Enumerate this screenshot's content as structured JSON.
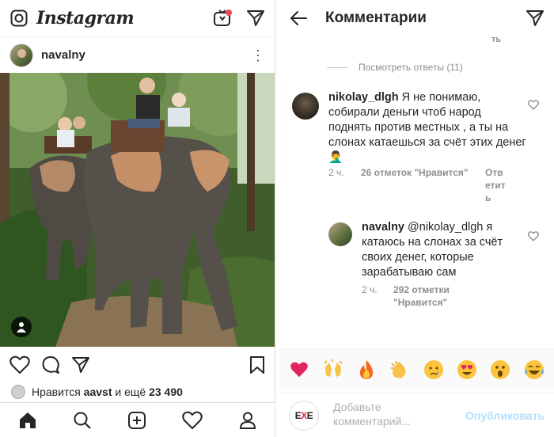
{
  "left": {
    "header": {
      "logo": "Instagram"
    },
    "post": {
      "username": "navalny",
      "more_glyph": "⋮",
      "likes_prefix": "Нравится",
      "likes_user": "aavst",
      "likes_middle": "и ещё",
      "likes_count": "23 490"
    },
    "icons": [
      "camera-icon",
      "igtv-icon",
      "direct-icon",
      "more-icon",
      "heart-icon",
      "comment-icon",
      "share-icon",
      "bookmark-icon",
      "home-icon",
      "search-icon",
      "add-icon",
      "activity-icon",
      "profile-icon",
      "tag-people-icon"
    ],
    "notification_color": "#ed4956"
  },
  "right": {
    "header": {
      "title": "Комментарии"
    },
    "cut_text": "ть",
    "view_replies": "Посмотреть ответы (11)",
    "comments": [
      {
        "username": "nikolay_dlgh",
        "text": "Я не понимаю, собирали деньги чтоб народ поднять против местных , а ты на слонах катаешься за счёт этих денег 🤦‍♂️",
        "time": "2 ч.",
        "likes": "26 отметок \"Нравится\"",
        "reply": "Ответить"
      },
      {
        "username": "navalny",
        "mention": "@nikolay_dlgh",
        "text": "я катаюсь на слонах за счёт своих денег, которые зарабатываю сам",
        "time": "2 ч.",
        "likes_line1": "292 отметки",
        "likes_line2": "\"Нравится\""
      }
    ],
    "emojis": [
      "❤️",
      "🙌",
      "🔥",
      "👏",
      "😢",
      "😍",
      "😮",
      "😂"
    ],
    "input": {
      "placeholder": "Добавьте комментарий...",
      "publish": "Опубликовать",
      "avatar_text_left": "E",
      "avatar_text_mid": "X",
      "avatar_text_right": "E"
    },
    "accent_color": "#b2dffc"
  }
}
